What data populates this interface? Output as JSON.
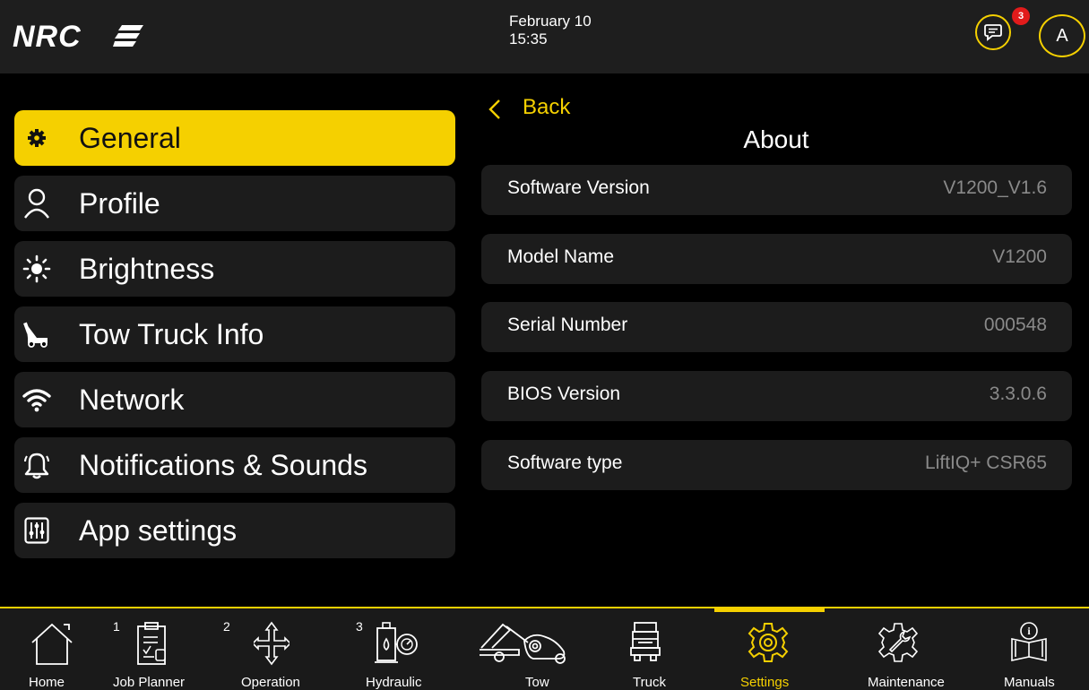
{
  "topbar": {
    "logo_text": "NRC",
    "date": "February 10",
    "time": "15:35",
    "message_badge": "3",
    "avatar_letter": "A"
  },
  "menu": {
    "items": [
      {
        "label": "General",
        "icon": "gear-icon",
        "active": true
      },
      {
        "label": "Profile",
        "icon": "person-icon"
      },
      {
        "label": "Brightness",
        "icon": "sun-icon"
      },
      {
        "label": "Tow Truck Info",
        "icon": "tow-truck-icon"
      },
      {
        "label": "Network",
        "icon": "wifi-icon"
      },
      {
        "label": "Notifications & Sounds",
        "icon": "bell-icon"
      },
      {
        "label": "App settings",
        "icon": "sliders-icon"
      }
    ]
  },
  "detail": {
    "back_label": "Back",
    "title": "About",
    "rows": [
      {
        "key": "Software Version",
        "value": "V1200_V1.6"
      },
      {
        "key": "Model Name",
        "value": "V1200"
      },
      {
        "key": "Serial Number",
        "value": "000548"
      },
      {
        "key": "BIOS Version",
        "value": "3.3.0.6"
      },
      {
        "key": "Software type",
        "value": "LiftIQ+ CSR65"
      }
    ]
  },
  "bottom_nav": {
    "items": [
      {
        "label": "Home",
        "icon": "home-icon",
        "number": ""
      },
      {
        "label": "Job Planner",
        "icon": "clipboard-icon",
        "number": "1"
      },
      {
        "label": "Operation",
        "icon": "move-arrows-icon",
        "number": "2"
      },
      {
        "label": "Hydraulic",
        "icon": "hydraulic-gauge-icon",
        "number": "3"
      },
      {
        "label": "Tow",
        "icon": "tow-icon",
        "number": ""
      },
      {
        "label": "Truck",
        "icon": "truck-icon",
        "number": ""
      },
      {
        "label": "Settings",
        "icon": "settings-gear-icon",
        "number": "",
        "active": true
      },
      {
        "label": "Maintenance",
        "icon": "wrench-gear-icon",
        "number": ""
      },
      {
        "label": "Manuals",
        "icon": "manual-icon",
        "number": ""
      }
    ]
  },
  "colors": {
    "accent": "#f5d000",
    "badge": "#e21b1b",
    "panel": "#1c1c1c",
    "value_text": "#8a8a8a"
  }
}
